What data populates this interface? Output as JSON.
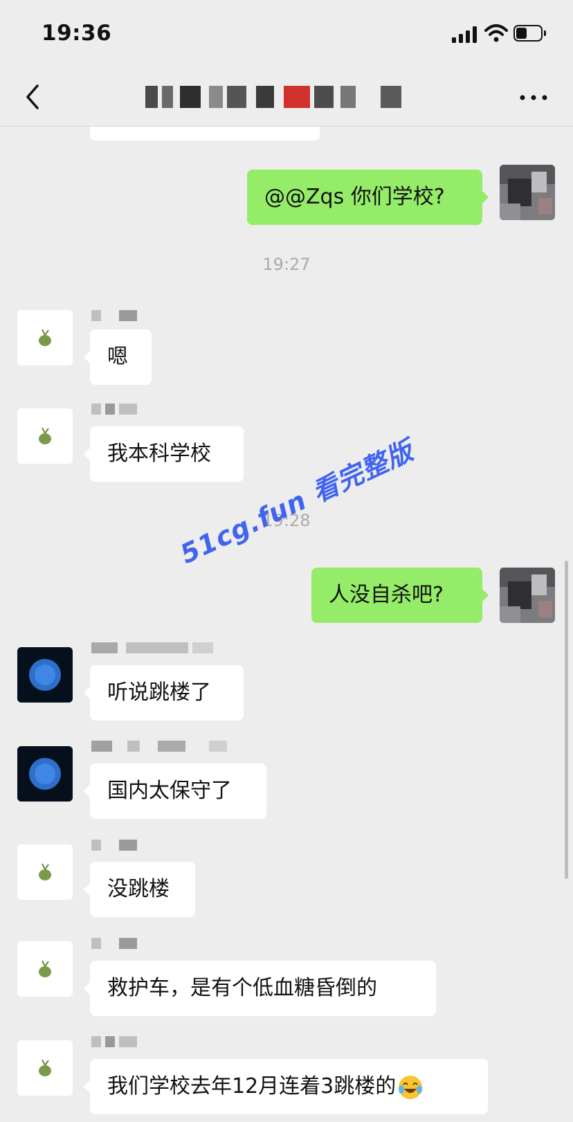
{
  "status_bar": {
    "time": "19:36"
  },
  "nav": {
    "title": "",
    "back_icon": "chevron-left-icon",
    "more_icon": "ellipsis-icon"
  },
  "messages": [
    {
      "type": "outgoing",
      "text": "@@Zqs 你们学校?"
    },
    {
      "type": "time",
      "text": "19:27"
    },
    {
      "type": "incoming",
      "avatar": "green-sprout-avatar",
      "text": "嗯"
    },
    {
      "type": "incoming",
      "avatar": "green-sprout-avatar",
      "text": "我本科学校"
    },
    {
      "type": "time",
      "text": "19:28"
    },
    {
      "type": "outgoing",
      "text": "人没自杀吧?"
    },
    {
      "type": "incoming",
      "avatar": "blue-orb-avatar",
      "text": "听说跳楼了"
    },
    {
      "type": "incoming",
      "avatar": "blue-orb-avatar",
      "text": "国内太保守了"
    },
    {
      "type": "incoming",
      "avatar": "green-sprout-avatar",
      "text": "没跳楼"
    },
    {
      "type": "incoming",
      "avatar": "green-sprout-avatar",
      "text": "救护车，是有个低血糖昏倒的"
    },
    {
      "type": "incoming",
      "avatar": "green-sprout-avatar",
      "text": "我们学校去年12月连着3跳楼的",
      "emoji": "laughing-crying-emoji"
    }
  ],
  "watermark": "51cg.fun 看完整版",
  "colors": {
    "background": "#ededed",
    "outgoing_bubble": "#95ec69",
    "incoming_bubble": "#ffffff",
    "timestamp": "#aaaaaa",
    "watermark": "#3f64f0"
  }
}
